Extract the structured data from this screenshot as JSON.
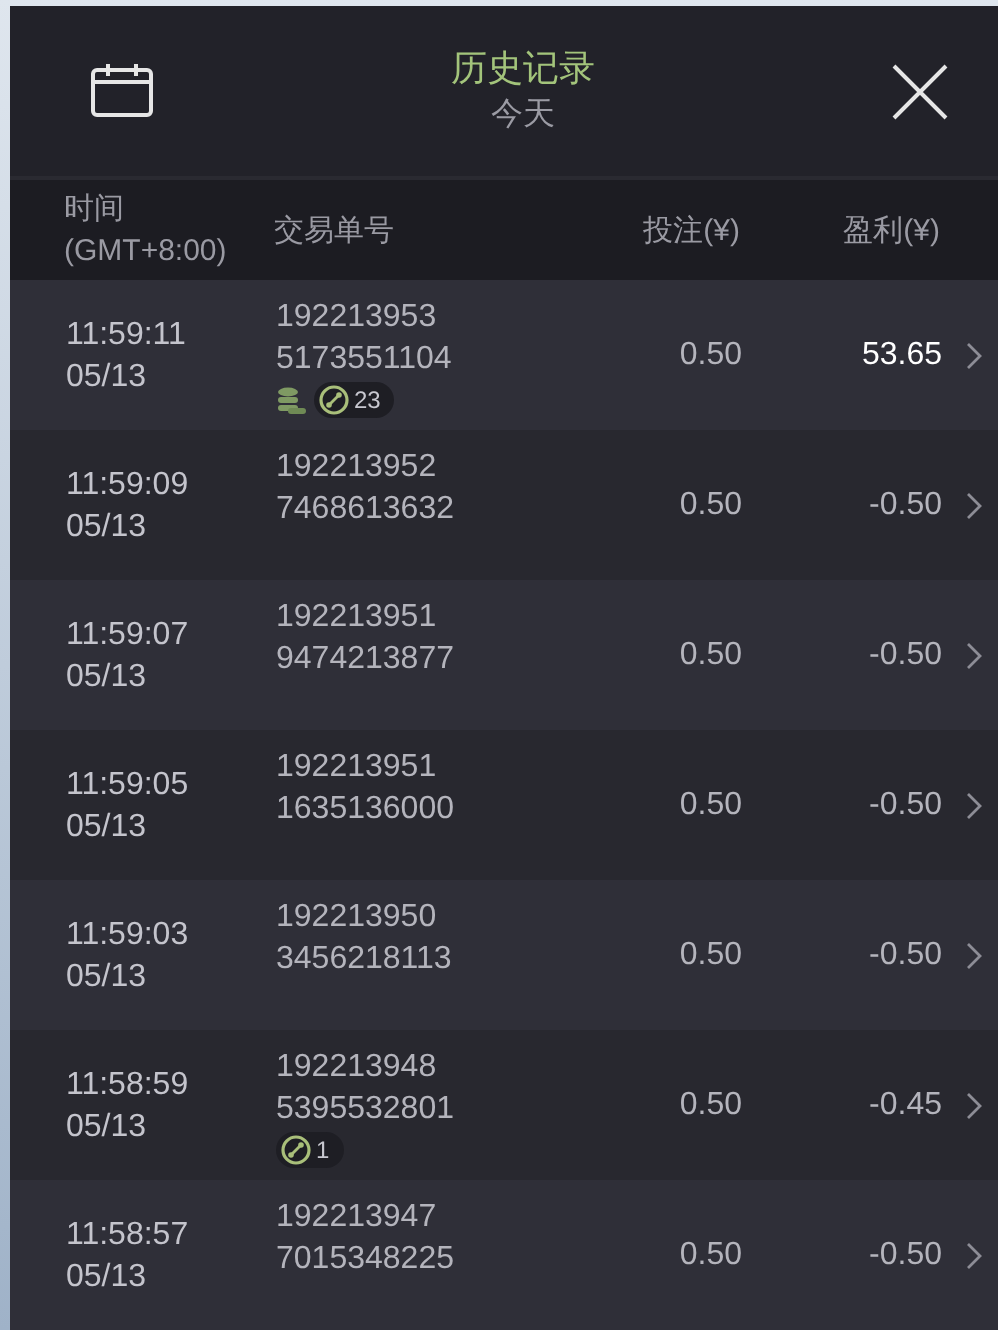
{
  "header": {
    "title": "历史记录",
    "subtitle": "今天"
  },
  "columns": [
    {
      "label": "时间\n(GMT+8:00)"
    },
    {
      "label": "交易单号"
    },
    {
      "label": "投注(¥)"
    },
    {
      "label": "盈利(¥)"
    }
  ],
  "rows": [
    {
      "time": "11:59:11",
      "date": "05/13",
      "order": [
        "192213953",
        "5173551104"
      ],
      "bet": "0.50",
      "profit": "53.65",
      "win": true,
      "badges": [
        {
          "kind": "coins"
        },
        {
          "kind": "combo",
          "count": "23"
        }
      ]
    },
    {
      "time": "11:59:09",
      "date": "05/13",
      "order": [
        "192213952",
        "7468613632"
      ],
      "bet": "0.50",
      "profit": "-0.50",
      "win": false
    },
    {
      "time": "11:59:07",
      "date": "05/13",
      "order": [
        "192213951",
        "9474213877"
      ],
      "bet": "0.50",
      "profit": "-0.50",
      "win": false
    },
    {
      "time": "11:59:05",
      "date": "05/13",
      "order": [
        "192213951",
        "1635136000"
      ],
      "bet": "0.50",
      "profit": "-0.50",
      "win": false
    },
    {
      "time": "11:59:03",
      "date": "05/13",
      "order": [
        "192213950",
        "3456218113"
      ],
      "bet": "0.50",
      "profit": "-0.50",
      "win": false
    },
    {
      "time": "11:58:59",
      "date": "05/13",
      "order": [
        "192213948",
        "5395532801"
      ],
      "bet": "0.50",
      "profit": "-0.45",
      "win": false,
      "badges": [
        {
          "kind": "combo",
          "count": "1"
        }
      ]
    },
    {
      "time": "11:58:57",
      "date": "05/13",
      "order": [
        "192213947",
        "7015348225"
      ],
      "bet": "0.50",
      "profit": "-0.50",
      "win": false
    }
  ]
}
